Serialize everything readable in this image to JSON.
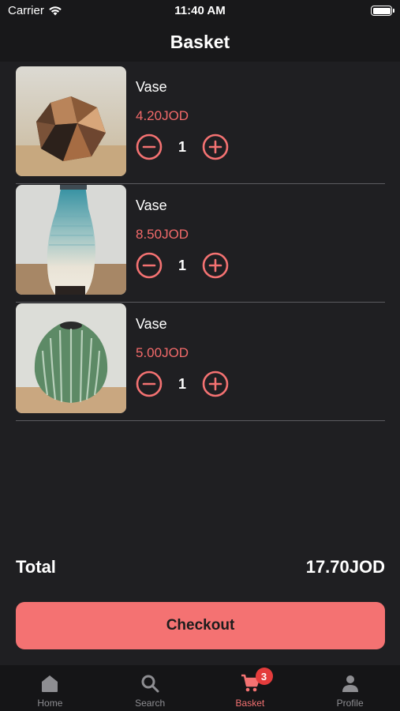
{
  "status_bar": {
    "carrier": "Carrier",
    "time": "11:40 AM",
    "icons": [
      "wifi-icon",
      "battery-icon"
    ]
  },
  "header": {
    "title": "Basket"
  },
  "basket": {
    "items": [
      {
        "name": "Vase",
        "price": "4.20JOD",
        "quantity": "1",
        "image": "geometric-copper-vase"
      },
      {
        "name": "Vase",
        "price": "8.50JOD",
        "quantity": "1",
        "image": "tall-teal-white-vase"
      },
      {
        "name": "Vase",
        "price": "5.00JOD",
        "quantity": "1",
        "image": "green-textured-ceramic-vase"
      }
    ]
  },
  "total": {
    "label": "Total",
    "value": "17.70JOD"
  },
  "checkout": {
    "label": "Checkout"
  },
  "tabs": [
    {
      "label": "Home",
      "icon": "home-icon",
      "active": false
    },
    {
      "label": "Search",
      "icon": "search-icon",
      "active": false
    },
    {
      "label": "Basket",
      "icon": "cart-icon",
      "active": true,
      "badge": "3"
    },
    {
      "label": "Profile",
      "icon": "person-icon",
      "active": false
    }
  ],
  "colors": {
    "accent": "#f47272",
    "price": "#f26a6a",
    "background": "#1f1f22",
    "badge": "#e43c3c"
  }
}
